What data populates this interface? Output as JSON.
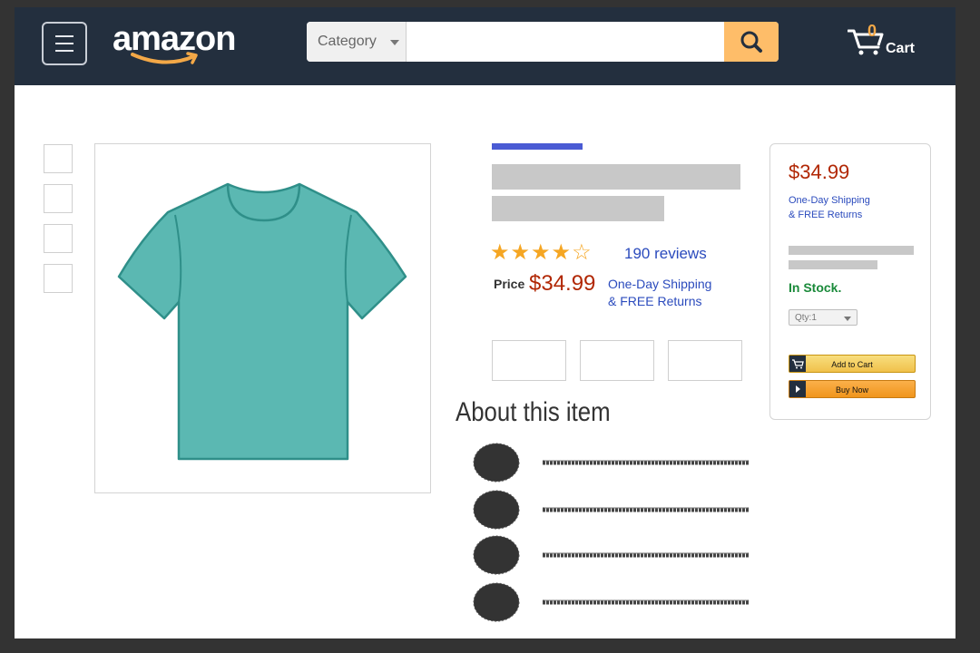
{
  "header": {
    "logo": "amazon",
    "search": {
      "category": "Category",
      "placeholder": ""
    },
    "cart": {
      "count": "0",
      "label": "Cart"
    }
  },
  "product": {
    "rating": {
      "stars": 4,
      "max": 5,
      "display": "★★★★☆",
      "reviews": "190 reviews"
    },
    "price_label": "Price",
    "price": "$34.99",
    "shipping_line1": "One-Day Shipping",
    "shipping_line2": "& FREE Returns"
  },
  "about": {
    "heading": "About this item",
    "bullet_count": 4
  },
  "buybox": {
    "price": "$34.99",
    "shipping_line1": "One-Day Shipping",
    "shipping_line2": "& FREE Returns",
    "stock": "In Stock.",
    "qty": "Qty:1",
    "add_to_cart": "Add to Cart",
    "buy_now": "Buy Now"
  },
  "colors": {
    "header_bg": "#232f3e",
    "search_button": "#febd69",
    "price_red": "#b12704",
    "link_blue": "#2b4bbd",
    "stock_green": "#1a8a3a",
    "tshirt": "#5bb8b2",
    "star": "#f5a623"
  }
}
